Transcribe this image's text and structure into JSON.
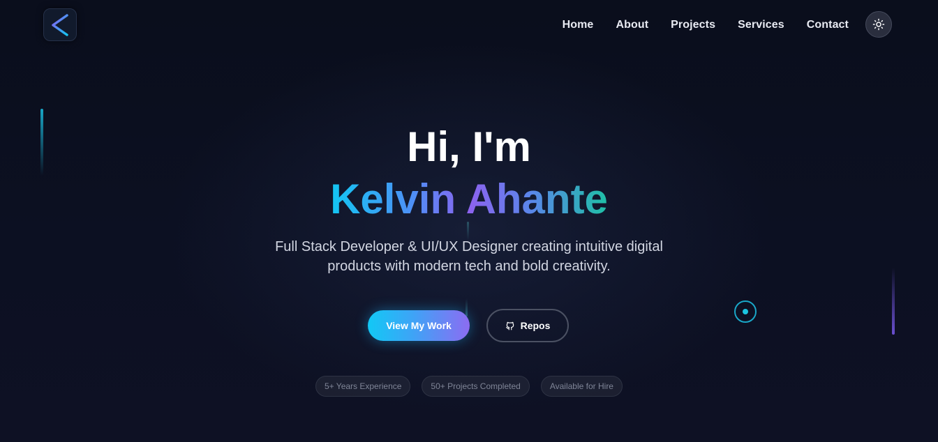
{
  "nav": {
    "logo_icon": "chevron-left-logo-icon",
    "links": [
      "Home",
      "About",
      "Projects",
      "Services",
      "Contact"
    ],
    "theme_toggle_icon": "sun-icon"
  },
  "hero": {
    "greeting": "Hi, I'm",
    "name": "Kelvin Ahante",
    "subtitle_line1": "Full Stack Developer & UI/UX Designer creating intuitive digital",
    "subtitle_line2": "products with modern tech and bold creativity."
  },
  "buttons": {
    "primary_label": "View My Work",
    "secondary_label": "Repos",
    "secondary_icon": "github-icon"
  },
  "badges": [
    "5+ Years Experience",
    "50+ Projects Completed",
    "Available for Hire"
  ],
  "colors": {
    "background": "#0b0f1e",
    "accent_cyan": "#12c6f2",
    "accent_purple": "#8c62ee",
    "accent_teal": "#1fc0a6"
  }
}
